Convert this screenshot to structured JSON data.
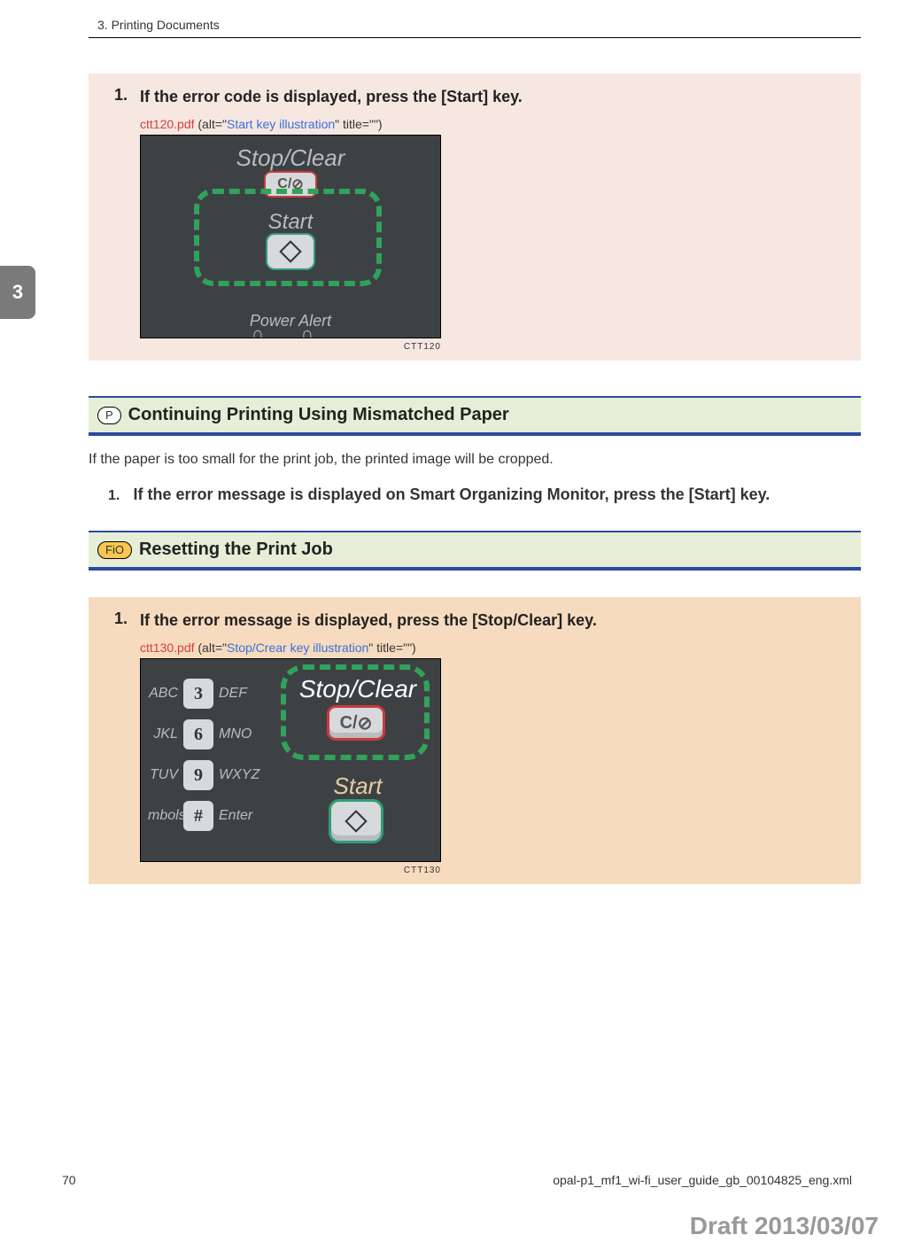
{
  "header": {
    "chapter_line": "3. Printing Documents"
  },
  "tab": {
    "num": "3"
  },
  "block1": {
    "num": "1.",
    "text": "If the error code is displayed, press the [Start] key.",
    "img_file": "ctt120.pdf",
    "img_paren_open": " (alt=\"",
    "img_alt": "Start key illustration",
    "img_paren_close": "\" title=\"\")",
    "caption": "CTT120",
    "labels": {
      "stop_clear": "Stop/Clear",
      "sc_key": "C/",
      "start": "Start",
      "power_alert": "Power  Alert"
    }
  },
  "section1": {
    "badge": "P",
    "title": "Continuing Printing Using Mismatched Paper",
    "body": "If the paper is too small for the print job, the printed image will be cropped.",
    "step_num": "1.",
    "step_text": "If the error message is displayed on Smart Organizing Monitor, press the [Start] key."
  },
  "section2": {
    "badge": "FiO",
    "title": "Resetting the Print Job"
  },
  "block2": {
    "num": "1.",
    "text": "If the error message is displayed, press the [Stop/Clear] key.",
    "img_file": "ctt130.pdf",
    "img_paren_open": " (alt=\"",
    "img_alt": "Stop/Crear key illustration",
    "img_paren_close": "\" title=\"\")",
    "caption": "CTT130",
    "keypad": {
      "r1l": "ABC",
      "r1k": "3",
      "r1r": "DEF",
      "r2l": "JKL",
      "r2k": "6",
      "r2r": "MNO",
      "r3l": "TUV",
      "r3k": "9",
      "r3r": "WXYZ",
      "r4l": "mbols",
      "r4k": "#",
      "r4r": "Enter"
    },
    "labels": {
      "stop_clear": "Stop/Clear",
      "sc_key": "C/",
      "start": "Start"
    }
  },
  "footer": {
    "page": "70",
    "file": "opal-p1_mf1_wi-fi_user_guide_gb_00104825_eng.xml"
  },
  "draft": "Draft 2013/03/07"
}
